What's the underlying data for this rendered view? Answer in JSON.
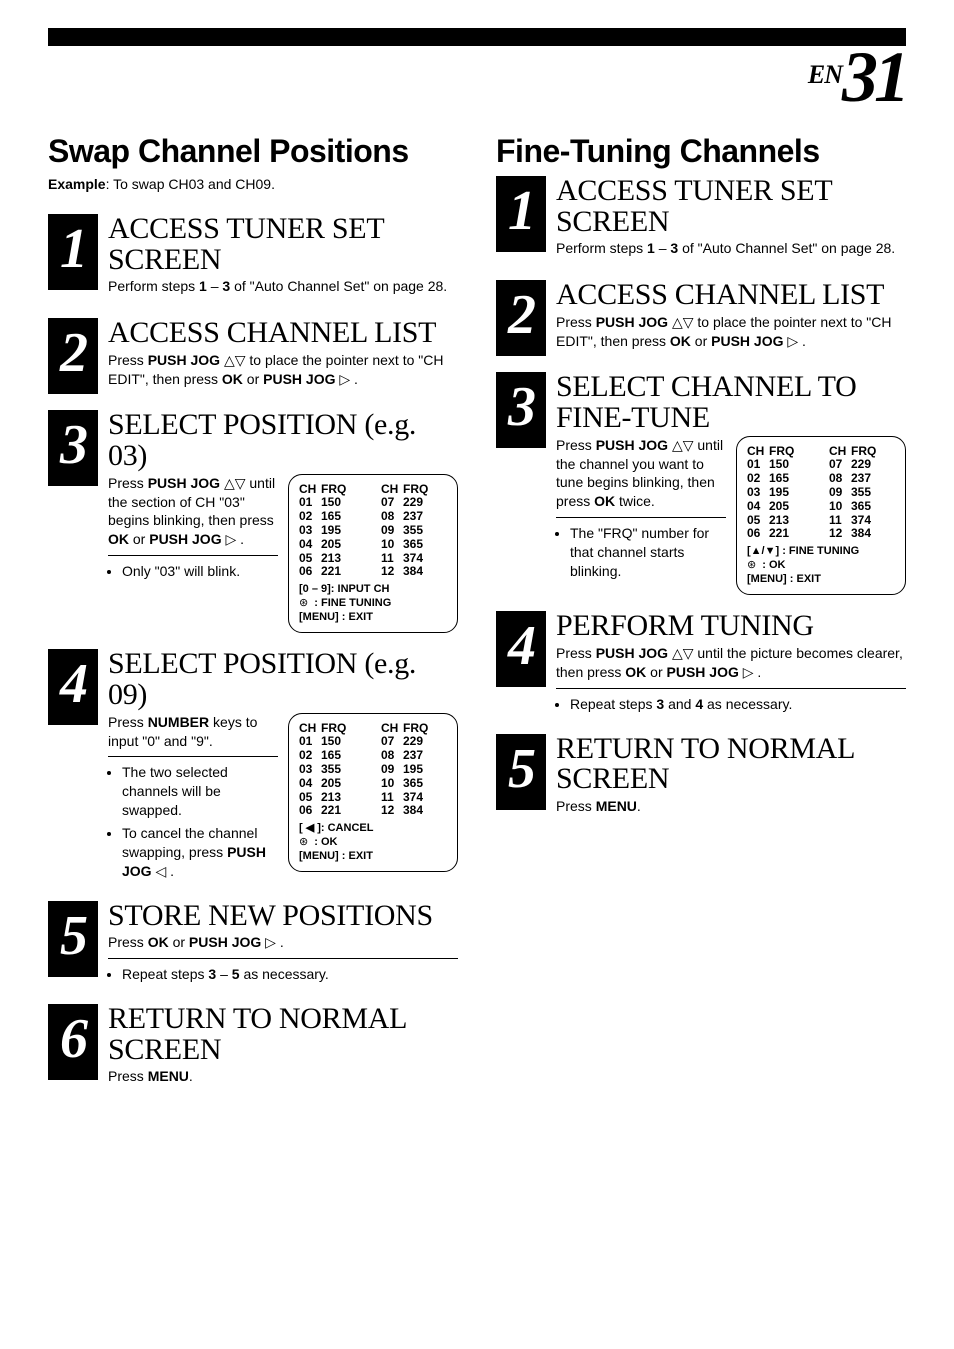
{
  "page": {
    "lang": "EN",
    "number": "31"
  },
  "left": {
    "heading": "Swap Channel Positions",
    "example_label": "Example",
    "example_text": ": To swap CH03 and CH09.",
    "s1": {
      "title": "ACCESS TUNER SET SCREEN",
      "body_pre": "Perform steps ",
      "b1": "1",
      "mid": " – ",
      "b2": "3",
      "body_post": " of \"Auto Channel Set\" on page 28."
    },
    "s2": {
      "title": "ACCESS CHANNEL LIST",
      "body_pre": "Press ",
      "b1": "PUSH JOG",
      "mid1": " ",
      "sym": "△▽",
      "mid2": " to place the pointer next to \"CH EDIT\", then press ",
      "b2": "OK",
      "mid3": " or ",
      "b3": "PUSH JOG",
      "tail": "▷ ."
    },
    "s3": {
      "title": "SELECT POSITION (e.g. 03)",
      "body_pre": "Press ",
      "b1": "PUSH JOG",
      "mid1": " △▽ until the section of CH \"03\" begins blinking, then press ",
      "b2": "OK",
      "mid2": " or ",
      "b3": "PUSH JOG",
      "tail": "▷ .",
      "bullet": "Only \"03\" will blink.",
      "osd_foot1": "[0 – 9]: INPUT CH",
      "osd_foot2": " : FINE TUNING",
      "osd_foot3": "[MENU] : EXIT"
    },
    "s4": {
      "title": "SELECT POSITION (e.g. 09)",
      "body_pre": "Press ",
      "b1": "NUMBER",
      "body_post": " keys to input \"0\" and \"9\".",
      "bul1": "The two selected channels will be swapped.",
      "bul2_pre": "To cancel the channel swapping, press ",
      "bul2_b": "PUSH JOG",
      "bul2_post": "◁ .",
      "osd_foot1": "[ ◀ ]: CANCEL",
      "osd_foot2": " : OK",
      "osd_foot3": "[MENU] : EXIT"
    },
    "s5": {
      "title": "STORE NEW POSITIONS",
      "body_pre": "Press ",
      "b1": "OK",
      "mid": " or ",
      "b2": "PUSH JOG",
      "tail": "▷ .",
      "bul_pre": "Repeat steps ",
      "bb1": "3",
      "bmid": " – ",
      "bb2": "5",
      "bul_post": " as necessary."
    },
    "s6": {
      "title": "RETURN TO NORMAL SCREEN",
      "body_pre": "Press ",
      "b1": "MENU",
      "tail": "."
    }
  },
  "right": {
    "heading": "Fine-Tuning Channels",
    "s1": {
      "title": "ACCESS TUNER SET SCREEN",
      "body_pre": "Perform steps ",
      "b1": "1",
      "mid": " – ",
      "b2": "3",
      "body_post": " of \"Auto Channel Set\" on page 28."
    },
    "s2": {
      "title": "ACCESS CHANNEL LIST",
      "body_pre": "Press ",
      "b1": "PUSH JOG",
      "mid1": " △▽ to place the pointer next to \"CH EDIT\", then press ",
      "b2": "OK",
      "mid2": " or ",
      "b3": "PUSH JOG",
      "tail": "▷ ."
    },
    "s3": {
      "title": "SELECT CHANNEL TO FINE-TUNE",
      "body_pre": "Press ",
      "b1": "PUSH JOG",
      "mid1": " △▽ until the channel you want to tune begins blinking, then press ",
      "b2": "OK",
      "mid2": " twice.",
      "bul": "The \"FRQ\" number for that channel starts blinking.",
      "osd_foot1": "[▲/▼] : FINE TUNING",
      "osd_foot2": " : OK",
      "osd_foot3": "[MENU] : EXIT"
    },
    "s4": {
      "title": "PERFORM TUNING",
      "body_pre": "Press ",
      "b1": "PUSH JOG",
      "mid1": " △▽ until the picture becomes clearer, then press ",
      "b2": "OK",
      "mid2": " or ",
      "b3": "PUSH JOG",
      "tail": "▷ .",
      "bul_pre": "Repeat steps ",
      "bb1": "3",
      "bmid": " and ",
      "bb2": "4",
      "bul_post": " as necessary."
    },
    "s5": {
      "title": "RETURN TO NORMAL SCREEN",
      "body_pre": "Press ",
      "b1": "MENU",
      "tail": "."
    }
  },
  "osd_head": {
    "ch": "CH",
    "frq": "FRQ"
  },
  "osd_a": [
    {
      "ch": "01",
      "frq": "150"
    },
    {
      "ch": "02",
      "frq": "165"
    },
    {
      "ch": "03",
      "frq": "195"
    },
    {
      "ch": "04",
      "frq": "205"
    },
    {
      "ch": "05",
      "frq": "213"
    },
    {
      "ch": "06",
      "frq": "221"
    }
  ],
  "osd_b": [
    {
      "ch": "07",
      "frq": "229"
    },
    {
      "ch": "08",
      "frq": "237"
    },
    {
      "ch": "09",
      "frq": "355"
    },
    {
      "ch": "10",
      "frq": "365"
    },
    {
      "ch": "11",
      "frq": "374"
    },
    {
      "ch": "12",
      "frq": "384"
    }
  ],
  "osd_swap_a": [
    {
      "ch": "01",
      "frq": "150"
    },
    {
      "ch": "02",
      "frq": "165"
    },
    {
      "ch": "03",
      "frq": "355"
    },
    {
      "ch": "04",
      "frq": "205"
    },
    {
      "ch": "05",
      "frq": "213"
    },
    {
      "ch": "06",
      "frq": "221"
    }
  ],
  "osd_swap_b": [
    {
      "ch": "07",
      "frq": "229"
    },
    {
      "ch": "08",
      "frq": "237"
    },
    {
      "ch": "09",
      "frq": "195"
    },
    {
      "ch": "10",
      "frq": "365"
    },
    {
      "ch": "11",
      "frq": "374"
    },
    {
      "ch": "12",
      "frq": "384"
    }
  ]
}
